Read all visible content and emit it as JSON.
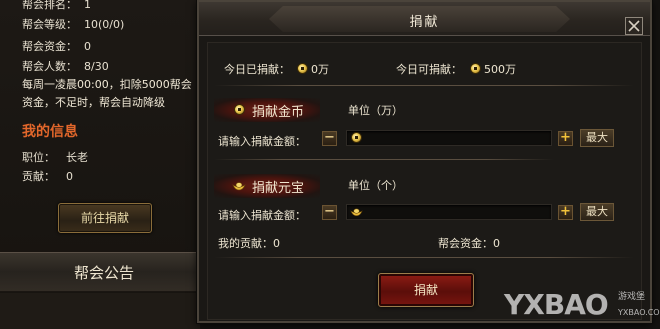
{
  "guild_info": {
    "rank_label": "帮会排名：",
    "rank_value": "1",
    "level_label": "帮会等级：",
    "level_value": "10(0/0)",
    "funds_label": "帮会资金：",
    "funds_value": "0",
    "members_label": "帮会人数：",
    "members_value": "8/30",
    "notice_line1": "每周一凌晨00:00，扣除5000帮会",
    "notice_line2": "资金，不足时，帮会自动降级"
  },
  "my_info": {
    "title": "我的信息",
    "position_label": "职位：",
    "position_value": "长老",
    "contribution_label": "贡献：",
    "contribution_value": "0",
    "goto_button": "前往捐献"
  },
  "announcement_tab": "帮会公告",
  "dialog": {
    "title": "捐献",
    "today_donated_label": "今日已捐献：",
    "today_donated_value": "0万",
    "today_available_label": "今日可捐献：",
    "today_available_value": "500万",
    "gold": {
      "section_label": "捐献金币",
      "unit": "单位（万）",
      "input_label": "请输入捐献金额：",
      "minus": "−",
      "plus": "+",
      "max_label": "最大"
    },
    "yuanbao": {
      "section_label": "捐献元宝",
      "unit": "单位（个）",
      "input_label": "请输入捐献金额：",
      "minus": "−",
      "plus": "+",
      "max_label": "最大"
    },
    "my_contribution": "我的贡献：0",
    "guild_funds": "帮会资金：0",
    "donate_button": "捐献"
  },
  "watermark": {
    "main": "YXBAO",
    "sub": "游戏堡",
    "url": "YXBAO.COM"
  },
  "icons": [
    "gold-coin-icon",
    "ingot-icon",
    "close-icon"
  ]
}
